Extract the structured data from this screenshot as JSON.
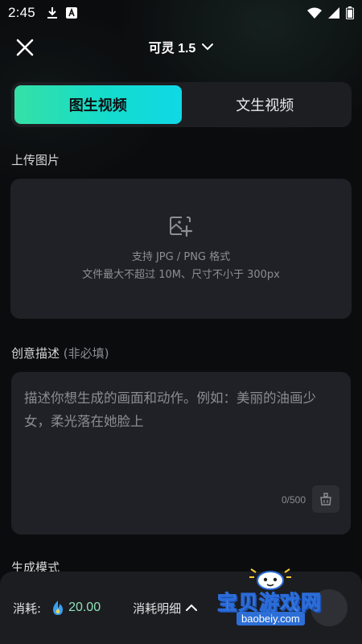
{
  "status_bar": {
    "time": "2:45"
  },
  "header": {
    "model_name": "可灵 1.5"
  },
  "mode_tabs": [
    {
      "label": "图生视频",
      "active": true
    },
    {
      "label": "文生视频",
      "active": false
    }
  ],
  "upload": {
    "section_title": "上传图片",
    "hint_line1": "支持 JPG / PNG 格式",
    "hint_line2": "文件最大不超过 10M、尺寸不小于 300px"
  },
  "description": {
    "section_title": "创意描述",
    "section_note": "(非必填)",
    "placeholder": "描述你想生成的画面和动作。例如：美丽的油画少女，柔光落在她脸上",
    "char_count": "0/500"
  },
  "generation_mode": {
    "section_title_partial": "生成模式"
  },
  "bottom_bar": {
    "cost_label": "消耗:",
    "cost_value": "20.00",
    "cost_detail_label": "消耗明细"
  },
  "watermark": {
    "name": "宝贝游戏网",
    "url": "baobeiy.com"
  },
  "colors": {
    "accent_gradient_start": "#35e0a6",
    "accent_gradient_end": "#10d8e6",
    "cost_value_color": "#8ee1b9"
  }
}
